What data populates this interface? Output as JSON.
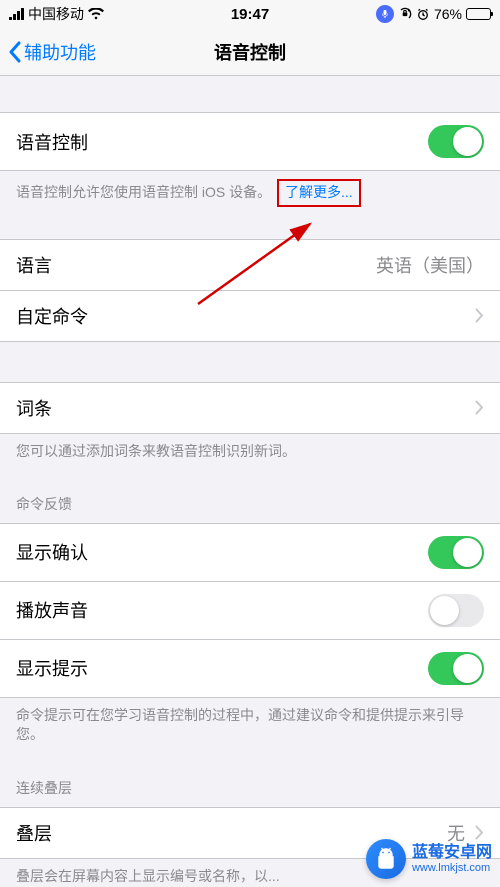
{
  "status_bar": {
    "carrier": "中国移动",
    "time": "19:47",
    "battery_percent": "76%"
  },
  "nav": {
    "back_label": "辅助功能",
    "title": "语音控制"
  },
  "sections": {
    "voice_control": {
      "label": "语音控制",
      "toggle_on": true,
      "footer": "语音控制允许您使用语音控制 iOS 设备。",
      "learn_more": "了解更多..."
    },
    "language": {
      "label": "语言",
      "value": "英语（美国）"
    },
    "custom_commands": {
      "label": "自定命令"
    },
    "vocabulary": {
      "label": "词条",
      "footer": "您可以通过添加词条来教语音控制识别新词。"
    },
    "command_feedback_header": "命令反馈",
    "show_confirmation": {
      "label": "显示确认",
      "toggle_on": true
    },
    "play_sound": {
      "label": "播放声音",
      "toggle_on": false
    },
    "show_hints": {
      "label": "显示提示",
      "toggle_on": true
    },
    "hints_footer": "命令提示可在您学习语音控制的过程中，通过建议命令和提供提示来引导您。",
    "continuous_overlay_header": "连续叠层",
    "overlay": {
      "label": "叠层",
      "value": "无"
    },
    "overlay_footer": "叠层会在屏幕内容上显示编号或名称，以..."
  },
  "watermark": {
    "line1": "蓝莓安卓网",
    "line2": "www.lmkjst.com"
  }
}
